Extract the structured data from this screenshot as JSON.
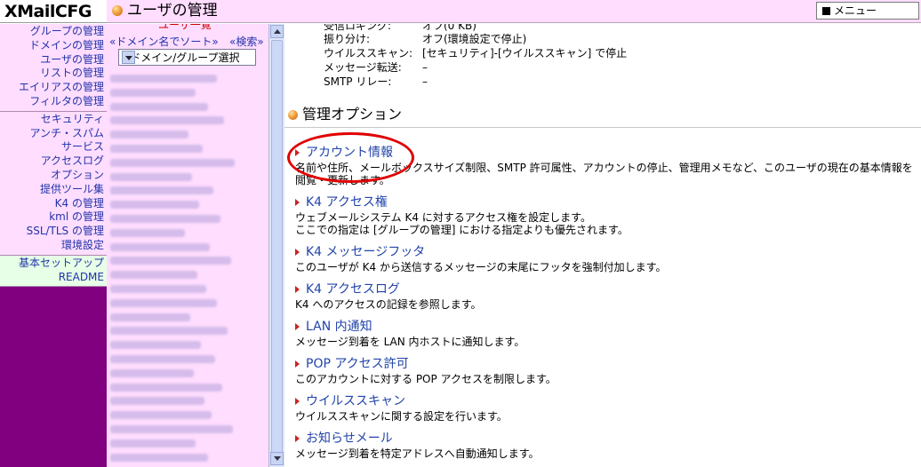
{
  "header": {
    "logo": "XMailCFG",
    "title": "ユーザの管理",
    "menu_label": "メニュー"
  },
  "nav": {
    "group1": [
      "グループの管理",
      "ドメインの管理",
      "ユーザの管理",
      "リストの管理",
      "エイリアスの管理",
      "フィルタの管理"
    ],
    "group2": [
      "セキュリティ",
      "アンチ・スパム",
      "サービス",
      "アクセスログ",
      "オプション",
      "提供ツール集",
      "K4 の管理",
      "kml の管理",
      "SSL/TLS の管理",
      "環境設定"
    ],
    "group3": [
      "基本セットアップ",
      "README"
    ]
  },
  "userlist": {
    "header": "ユーザ一覧",
    "sort_link": "«ドメイン名でソート»",
    "search_link": "«検索»",
    "select_value": "▽ドメイン/グループ選択"
  },
  "settings": [
    {
      "key": "受信ロギング:",
      "value": "オフ(0 KB)"
    },
    {
      "key": "振り分け:",
      "value": "オフ(環境設定で停止)"
    },
    {
      "key": "ウイルススキャン:",
      "value": "[セキュリティ]-[ウイルススキャン] で停止"
    },
    {
      "key": "メッセージ転送:",
      "value": "–"
    },
    {
      "key": "SMTP リレー:",
      "value": "–"
    }
  ],
  "section_title": "管理オプション",
  "options": [
    {
      "label": "アカウント情報",
      "desc": "名前や住所、メールボックスサイズ制限、SMTP 許可属性、アカウントの停止、管理用メモなど、このユーザの現在の基本情報を閲覧・更新します。"
    },
    {
      "label": "K4 アクセス権",
      "desc": "ウェブメールシステム K4 に対するアクセス権を設定します。\nここでの指定は [グループの管理] における指定よりも優先されます。"
    },
    {
      "label": "K4 メッセージフッタ",
      "desc": "このユーザが K4 から送信するメッセージの末尾にフッタを強制付加します。"
    },
    {
      "label": "K4 アクセスログ",
      "desc": "K4 へのアクセスの記録を参照します。"
    },
    {
      "label": "LAN 内通知",
      "desc": "メッセージ到着を LAN 内ホストに通知します。"
    },
    {
      "label": "POP アクセス許可",
      "desc": "このアカウントに対する POP アクセスを制限します。"
    },
    {
      "label": "ウイルススキャン",
      "desc": "ウイルススキャンに関する設定を行います。"
    },
    {
      "label": "お知らせメール",
      "desc": "メッセージ到着を特定アドレスへ自動通知します。"
    }
  ]
}
